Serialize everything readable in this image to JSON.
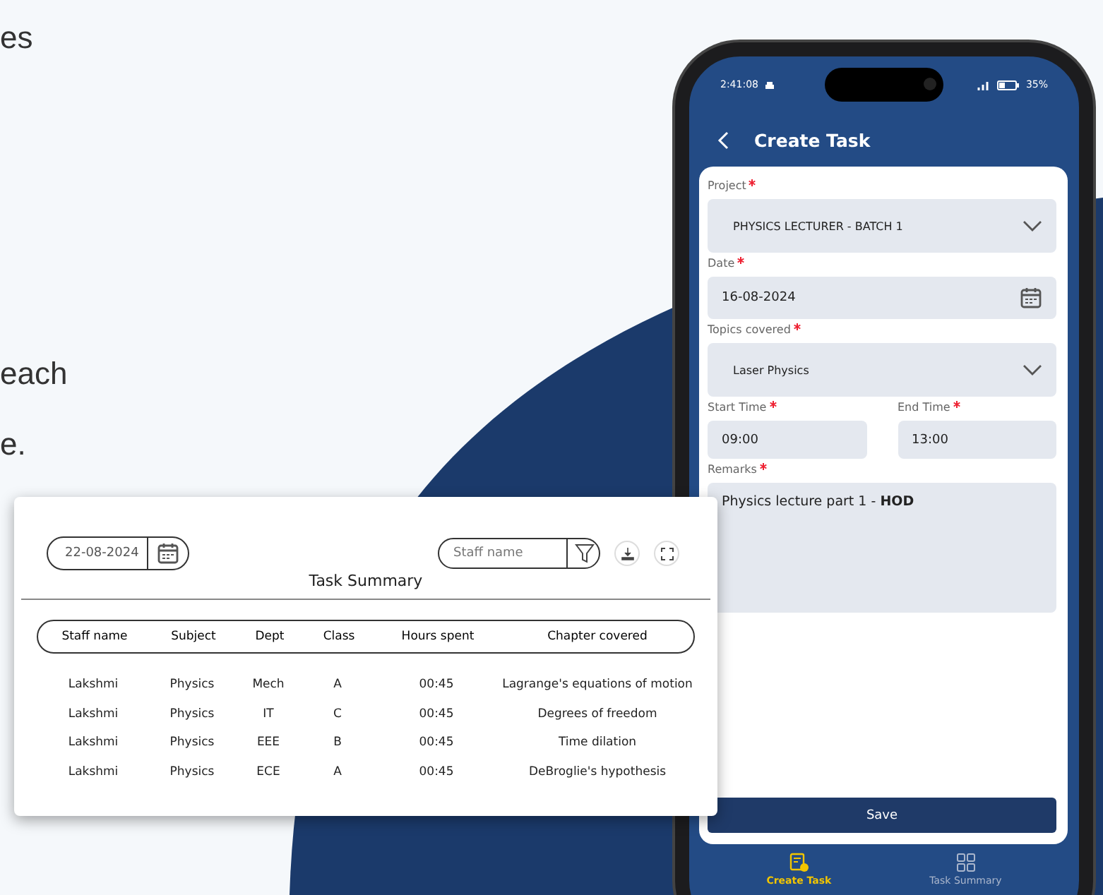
{
  "page_text": [
    {
      "text": "es"
    },
    {
      "text": "each"
    },
    {
      "text": "e."
    }
  ],
  "phone": {
    "status_bar": {
      "time": "2:41:08",
      "battery": "35%"
    },
    "title": "Create Task",
    "fields": [
      {
        "kind": "dropdown",
        "label": "Project",
        "required": true,
        "value": "PHYSICS LECTURER - BATCH 1"
      },
      {
        "kind": "date",
        "label": "Date",
        "required": true,
        "value": "16-08-2024"
      },
      {
        "kind": "dropdown",
        "label": "Topics covered",
        "required": true,
        "value": "Laser Physics"
      },
      {
        "kind": "time",
        "label": "Start Time",
        "required": true,
        "value": "09:00"
      },
      {
        "kind": "time",
        "label": "End Time",
        "required": true,
        "value": "13:00"
      },
      {
        "kind": "textarea",
        "label": "Remarks",
        "required": true,
        "value": "Physics lecture part 1 - **HOD**"
      }
    ],
    "save_button": "Save",
    "nav": [
      {
        "label": "Create Task",
        "selected": true
      },
      {
        "label": "Task Summary",
        "selected": false
      }
    ]
  },
  "task_summary": {
    "date": "22-08-2024",
    "staff_search": {
      "placeholder": "Staff name"
    },
    "title": "Task Summary",
    "columns": [
      "Staff name",
      "Subject",
      "Dept",
      "Class",
      "Hours spent",
      "Chapter covered"
    ],
    "rows": [
      [
        "Lakshmi",
        "Physics",
        "Mech",
        "A",
        "00:45",
        "Lagrange's equations of motion"
      ],
      [
        "Lakshmi",
        "Physics",
        "IT",
        "C",
        "00:45",
        "Degrees of freedom"
      ],
      [
        "Lakshmi",
        "Physics",
        "EEE",
        "B",
        "00:45",
        "Time dilation"
      ],
      [
        "Lakshmi",
        "Physics",
        "ECE",
        "A",
        "00:45",
        "DeBroglie's hypothesis"
      ]
    ]
  }
}
